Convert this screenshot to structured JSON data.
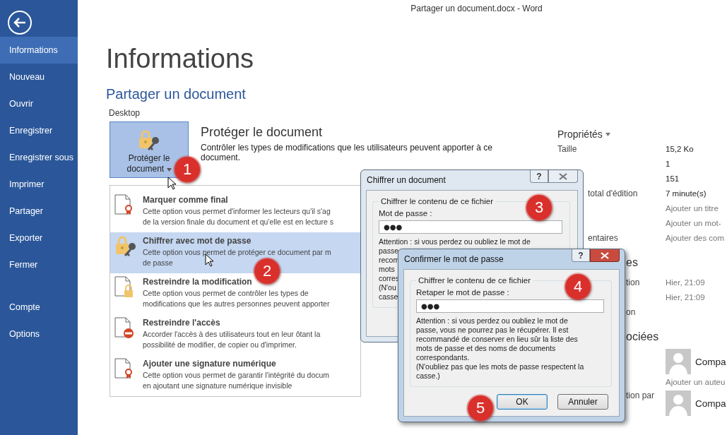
{
  "window": {
    "title": "Partager un document.docx - Word"
  },
  "sidebar": {
    "items": [
      {
        "label": "Informations",
        "selected": true
      },
      {
        "label": "Nouveau",
        "selected": false
      },
      {
        "label": "Ouvrir",
        "selected": false
      },
      {
        "label": "Enregistrer",
        "selected": false
      },
      {
        "label": "Enregistrer sous",
        "selected": false
      },
      {
        "label": "Imprimer",
        "selected": false
      },
      {
        "label": "Partager",
        "selected": false
      },
      {
        "label": "Exporter",
        "selected": false
      },
      {
        "label": "Fermer",
        "selected": false
      }
    ],
    "bottom_items": [
      {
        "label": "Compte",
        "selected": false
      },
      {
        "label": "Options",
        "selected": false
      }
    ]
  },
  "page": {
    "title": "Informations",
    "document_name": "Partager un document",
    "location": "Desktop"
  },
  "protect": {
    "button_label": "Protéger le document",
    "title": "Protéger le document",
    "description": "Contrôler les types de modifications que les utilisateurs peuvent apporter à ce document."
  },
  "protect_menu": [
    {
      "kind": "final",
      "title": "Marquer comme final",
      "lines": [
        "Cette option vous permet d'informer les lecteurs qu'il s'ag",
        "de la version finale du document et qu'elle est en lecture s"
      ],
      "selected": false
    },
    {
      "kind": "encrypt",
      "title": "Chiffrer avec mot de passe",
      "lines": [
        "Cette option vous permet de protéger ce document par m",
        "de passe"
      ],
      "selected": true
    },
    {
      "kind": "restrict-edit",
      "title": "Restreindre la modification",
      "lines": [
        "Cette option vous permet de contrôler les types de",
        "modifications que les autres personnes peuvent apporter"
      ],
      "selected": false
    },
    {
      "kind": "restrict-access",
      "title": "Restreindre l'accès",
      "lines": [
        "Accorder l'accès à des utilisateurs tout en leur ôtant la",
        "possibilité de modifier, de copier ou d'imprimer."
      ],
      "selected": false
    },
    {
      "kind": "signature",
      "title": "Ajouter une signature numérique",
      "lines": [
        "Cette option vous permet de garantir l'intégrité du docum",
        "en ajoutant une signature numérique invisible"
      ],
      "selected": false
    }
  ],
  "properties": {
    "title": "Propriétés",
    "sections": [
      {
        "rows": [
          {
            "label": "Taille",
            "value": "15,2 Ko",
            "kind": "value"
          },
          {
            "value": "1",
            "kind": "value"
          },
          {
            "value": "151",
            "kind": "value"
          },
          {
            "label": "total d'édition",
            "value": "7 minute(s)",
            "kind": "value"
          },
          {
            "value": "Ajouter un titre",
            "kind": "muted"
          },
          {
            "value": "Ajouter un mot-",
            "kind": "muted"
          },
          {
            "label": "entaires",
            "value": "Ajouter des com",
            "kind": "muted"
          }
        ]
      },
      {
        "heading": "es",
        "rows": [
          {
            "label": "tion",
            "value": "Hier, 21:09",
            "kind": "muted"
          },
          {
            "value": "Hier, 21:09",
            "kind": "muted"
          },
          {
            "label": "on",
            "kind": "value"
          }
        ]
      },
      {
        "heading": "ociées",
        "rows": [
          {
            "value": "Compa",
            "kind": "person"
          },
          {
            "value": "Ajouter un auteu",
            "kind": "muted"
          },
          {
            "label": "tion par",
            "value": "Compa",
            "kind": "person"
          }
        ]
      }
    ]
  },
  "dialogs": [
    {
      "title": "Chiffrer un document",
      "help": "?",
      "active": false,
      "group": "Chiffrer le contenu de ce fichier",
      "field_label": "Mot de passe :",
      "value": "●●●",
      "warning_lines": [
        "Attention : si vous perdez ou oubliez le mot de",
        "passe",
        "recom",
        "mots",
        "corres",
        "(N'ou",
        "casse"
      ]
    },
    {
      "title": "Confirmer le mot de passe",
      "help": "?",
      "active": true,
      "group": "Chiffrer le contenu de ce fichier",
      "field_label": "Retaper le mot de passe :",
      "value": "●●●",
      "warning_lines": [
        "Attention : si vous perdez ou oubliez le mot de",
        "passe, vous ne pourrez pas le récupérer. Il est",
        "recommandé de conserver en lieu sûr la liste des",
        "mots de passe et des noms de documents",
        "correspondants.",
        "(N'oubliez pas que les mots de passe respectent la",
        "casse.)"
      ],
      "buttons": [
        {
          "label": "OK",
          "default": true
        },
        {
          "label": "Annuler",
          "default": false
        }
      ]
    }
  ],
  "step_badges": [
    "1",
    "2",
    "3",
    "4",
    "5"
  ]
}
